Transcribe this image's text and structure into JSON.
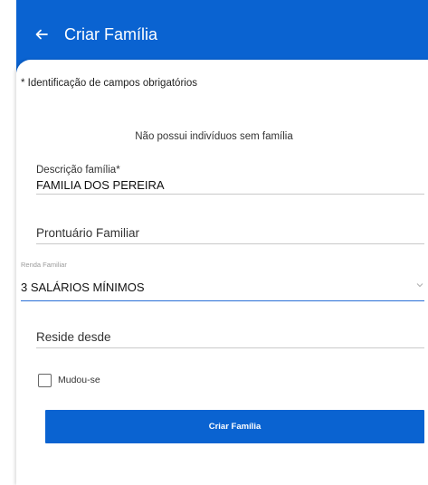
{
  "app_bar": {
    "title": "Criar Família",
    "back_icon": "arrow-left-icon"
  },
  "form": {
    "required_note": "* Identificação de campos obrigatórios",
    "no_individuals_message": "Não possui indivíduos sem família",
    "descricao": {
      "label": "Descrição família*",
      "value": "FAMILIA DOS PEREIRA"
    },
    "prontuario": {
      "placeholder": "Prontuário Familiar"
    },
    "renda": {
      "label": "Renda Familiar",
      "value": "3 SALÁRIOS MÍNIMOS",
      "icon": "chevron-down-icon"
    },
    "reside_desde": {
      "placeholder": "Reside desde"
    },
    "mudou_se": {
      "label": "Mudou-se",
      "checked": false
    }
  },
  "actions": {
    "submit_label": "Criar Família"
  },
  "colors": {
    "primary": "#0a63d1",
    "focus_underline": "#2a6fd6",
    "divider": "#c9c9c9"
  }
}
